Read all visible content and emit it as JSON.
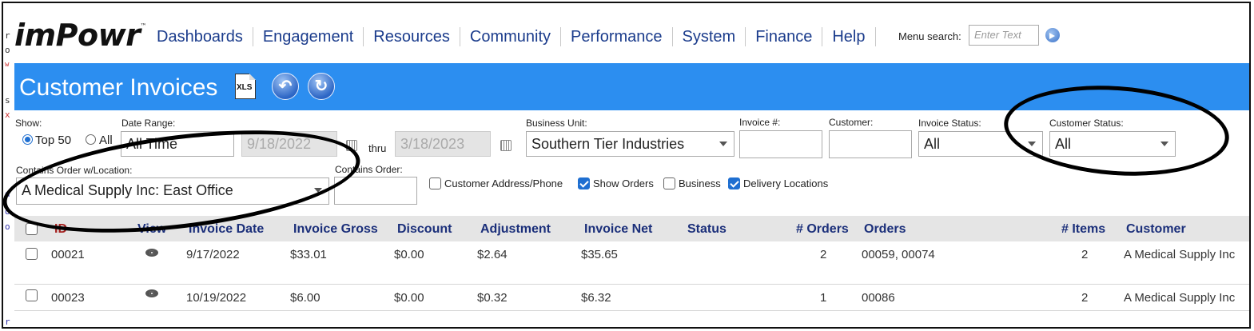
{
  "gutter": [
    "r",
    "o",
    "w",
    "s",
    "x",
    "d",
    "o",
    "o",
    "r"
  ],
  "logo": {
    "text": "imPowr",
    "tm": "™"
  },
  "menu": [
    "Dashboards",
    "Engagement",
    "Resources",
    "Community",
    "Performance",
    "System",
    "Finance",
    "Help"
  ],
  "menu_search": {
    "label": "Menu search:",
    "placeholder": "Enter Text"
  },
  "page_title": "Customer Invoices",
  "toolbar": {
    "xls_label": "XLS"
  },
  "filters": {
    "show": {
      "label": "Show:",
      "options": [
        "Top 50",
        "All"
      ],
      "selected": "Top 50"
    },
    "date_range": {
      "label": "Date Range:",
      "value": "All Time",
      "from": "9/18/2022",
      "thru_label": "thru",
      "to": "3/18/2023"
    },
    "business_unit": {
      "label": "Business Unit:",
      "value": "Southern Tier Industries"
    },
    "invoice_no": {
      "label": "Invoice #:",
      "value": ""
    },
    "customer": {
      "label": "Customer:",
      "value": ""
    },
    "invoice_status": {
      "label": "Invoice Status:",
      "value": "All"
    },
    "customer_status": {
      "label": "Customer Status:",
      "value": "All"
    },
    "order_location": {
      "label": "Contains Order w/Location:",
      "value": "A Medical Supply Inc: East Office"
    },
    "contains_order": {
      "label": "Contains Order:",
      "value": ""
    },
    "checkboxes": [
      {
        "label": "Customer Address/Phone",
        "checked": false
      },
      {
        "label": "Show Orders",
        "checked": true
      },
      {
        "label": "Business",
        "checked": false
      },
      {
        "label": "Delivery Locations",
        "checked": true
      }
    ]
  },
  "table": {
    "columns": [
      "ID",
      "View",
      "Invoice Date",
      "Invoice Gross",
      "Discount",
      "Adjustment",
      "Invoice Net",
      "Status",
      "# Orders",
      "Orders",
      "# Items",
      "Customer"
    ],
    "rows": [
      {
        "id": "00021",
        "date": "9/17/2022",
        "gross": "$33.01",
        "discount": "$0.00",
        "adjustment": "$2.64",
        "net": "$35.65",
        "status": "",
        "num_orders": "2",
        "orders": "00059, 00074",
        "num_items": "2",
        "customer": "A Medical Supply Inc"
      },
      {
        "id": "00023",
        "date": "10/19/2022",
        "gross": "$6.00",
        "discount": "$0.00",
        "adjustment": "$0.32",
        "net": "$6.32",
        "status": "",
        "num_orders": "1",
        "orders": "00086",
        "num_items": "2",
        "customer": "A Medical Supply Inc"
      }
    ]
  },
  "colors": {
    "header_bar": "#2c8ef0",
    "nav_link": "#1b3c8c",
    "column_header": "#1b2f7a",
    "id_header": "#a5211f",
    "checkbox_on": "#1f6fd1"
  }
}
